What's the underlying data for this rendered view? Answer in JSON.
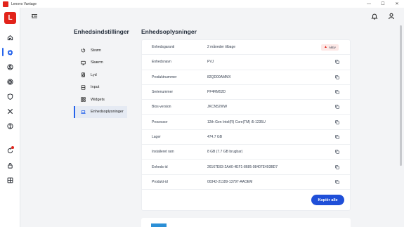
{
  "window": {
    "title": "Lenovo Vantage",
    "min_glyph": "—",
    "max_glyph": "☐",
    "close_glyph": "✕"
  },
  "brand": {
    "logo_text": "L",
    "accent": "#e2231a",
    "primary": "#1f4fd8"
  },
  "rail": [
    {
      "icon": "home-icon"
    },
    {
      "icon": "gear-icon",
      "active": true
    },
    {
      "icon": "account-icon"
    },
    {
      "icon": "wifi-icon"
    },
    {
      "icon": "shield-icon"
    },
    {
      "icon": "tools-icon"
    },
    {
      "icon": "help-icon"
    },
    {
      "icon": "device-updates-icon",
      "badge": true
    },
    {
      "icon": "lock-icon"
    },
    {
      "icon": "grid-icon"
    }
  ],
  "settings": {
    "title": "Enhedsindstillinger",
    "menu": [
      {
        "label": "Strøm",
        "icon": "power-icon"
      },
      {
        "label": "Skærm",
        "icon": "display-icon"
      },
      {
        "label": "Lyd",
        "icon": "audio-icon"
      },
      {
        "label": "Input",
        "icon": "keyboard-icon"
      },
      {
        "label": "Widgets",
        "icon": "widgets-icon"
      },
      {
        "label": "Enhedsoplysninger",
        "icon": "laptop-icon",
        "active": true
      }
    ]
  },
  "device_info": {
    "title": "Enhedsoplysninger",
    "rows": [
      {
        "label": "Enhedsgaranti",
        "value": "2 måneder tilbage",
        "badge": "Aktiv"
      },
      {
        "label": "Enhedsnavn",
        "value": "PVJ"
      },
      {
        "label": "Produktnummer",
        "value": "82QD00AMMX"
      },
      {
        "label": "Serienummer",
        "value": "PF4RM52D"
      },
      {
        "label": "Bios-version",
        "value": "JKCN52WW"
      },
      {
        "label": "Processor",
        "value": "12th Gen Intel(R) Core(TM) i5-1235U"
      },
      {
        "label": "Lager",
        "value": "474.7 GB"
      },
      {
        "label": "Installeret ram",
        "value": "8 GB (7.7 GB brugbar)"
      },
      {
        "label": "Enheds-id",
        "value": "26167E83-2AA0-4EF1-8685-08407E493BD7"
      },
      {
        "label": "Produkt-id",
        "value": "00342-21189-13797-AAOEM"
      }
    ],
    "copy_all_label": "Kopiér alle"
  }
}
